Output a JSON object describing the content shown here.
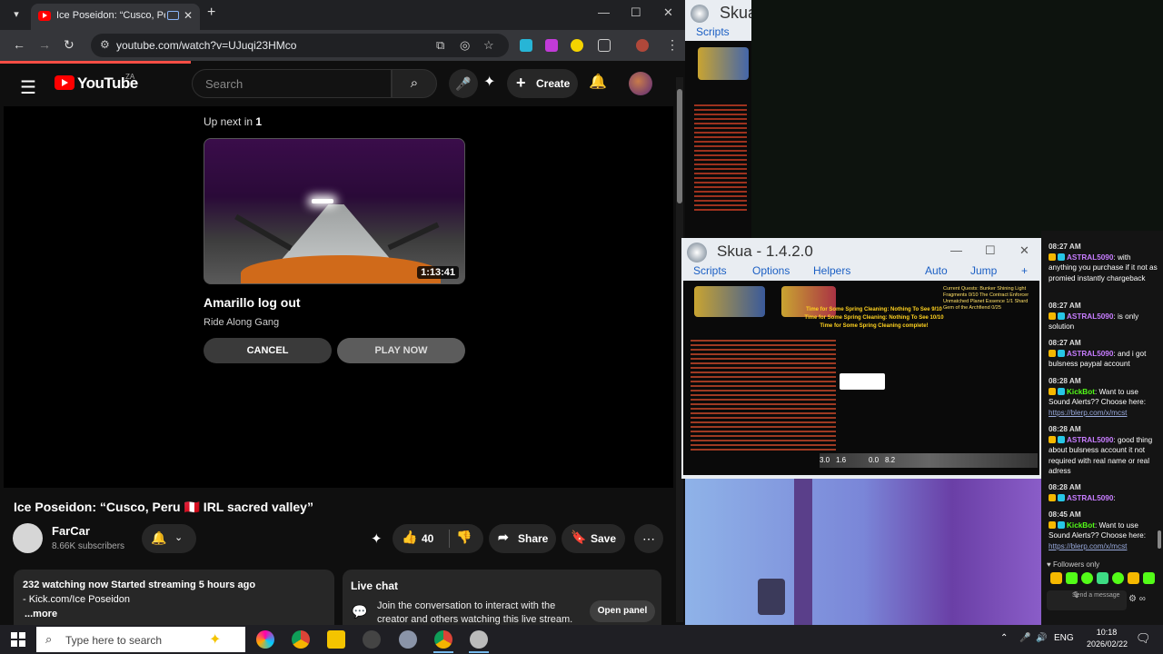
{
  "browser": {
    "tab_title": "Ice Poseidon: “Cusco, Peru",
    "url": "youtube.com/watch?v=UJuqi23HMco",
    "new_tab": "+",
    "min": "—",
    "max": "☐",
    "close": "✕"
  },
  "youtube": {
    "brand": "YouTube",
    "region": "ZA",
    "search_placeholder": "Search",
    "create_label": "Create",
    "up_next_prefix": "Up next in ",
    "up_next_count": "1",
    "next_duration": "1:13:41",
    "next_title": "Amarillo log out",
    "next_channel": "Ride Along Gang",
    "cancel_label": "CANCEL",
    "play_now_label": "PLAY NOW",
    "video_title": "Ice Poseidon: “Cusco, Peru 🇵🇪 IRL sacred valley”",
    "channel_name": "FarCar",
    "subscribers": "8.66K subscribers",
    "likes": "40",
    "share_label": "Share",
    "save_label": "Save",
    "desc_line1": "232 watching now  Started streaming 5 hours ago",
    "desc_line2": "- Kick.com/Ice Poseidon",
    "desc_more": "...more",
    "live_chat_title": "Live chat",
    "live_chat_text": "Join the conversation to interact with the creator and others watching this live stream.",
    "open_panel_label": "Open panel"
  },
  "skua_small": {
    "title": "Skua",
    "menu_scripts": "Scripts"
  },
  "skua": {
    "title": "Skua - 1.4.2.0",
    "menu": [
      "Scripts",
      "Options",
      "Helpers",
      "Auto",
      "Jump",
      "+"
    ],
    "game_msg": "Time for Some Spring Cleaning: Nothing To See 9/10 Time for Some Spring Cleaning: Nothing To See 10/10 Time for Some Spring Cleaning complete!",
    "quest_text": "Current Quests: Bunker Shining Light Fragments 0/10 The Contract Enforcer Unmatched Planet Essence 1/1 Shard Gem of the Archfiend 0/25",
    "hotbar_values": [
      "3.0",
      "1.6",
      "0.0",
      "8.2"
    ]
  },
  "chat": {
    "messages": [
      {
        "time": "08:27 AM",
        "user": "ASTRAL5090",
        "text": ": with anything you purchase if it not as promied instantly chargeback"
      },
      {
        "time": "08:27 AM",
        "user": "ASTRAL5090",
        "text": ": is only solution"
      },
      {
        "time": "08:27 AM",
        "user": "ASTRAL5090",
        "text": ": and i got bulsness paypal account"
      },
      {
        "time": "08:28 AM",
        "user": "KickBot",
        "text": ": Want to use Sound Alerts?? Choose here:",
        "link": "https://blerp.com/x/mcst"
      },
      {
        "time": "08:28 AM",
        "user": "ASTRAL5090",
        "text": ": good thing about bulsness account it not required with real name or real adress"
      },
      {
        "time": "08:28 AM",
        "user": "ASTRAL5090",
        "text": ":"
      },
      {
        "time": "08:45 AM",
        "user": "KickBot",
        "text": ": Want to use Sound Alerts?? Choose here:",
        "link": "https://blerp.com/x/mcst"
      }
    ],
    "followers_only": "♥ Followers only",
    "send_placeholder": "Send a message"
  },
  "taskbar": {
    "search_placeholder": "Type here to search",
    "lang": "ENG",
    "time": "10:18",
    "date": "2026/02/22"
  }
}
